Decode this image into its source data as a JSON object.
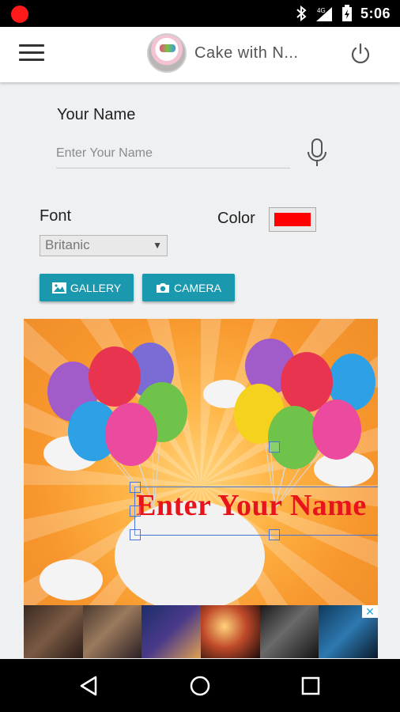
{
  "status_bar": {
    "time": "5:06",
    "network": "4G"
  },
  "app_bar": {
    "title": "Cake with N...",
    "menu_icon": "hamburger-menu-icon",
    "power_icon": "power-icon"
  },
  "form": {
    "name_label": "Your Name",
    "name_placeholder": "Enter Your Name",
    "font_label": "Font",
    "font_value": "Britanic",
    "color_label": "Color",
    "color_value": "#ff0000",
    "gallery_label": "GALLERY",
    "camera_label": "CAMERA"
  },
  "canvas": {
    "overlay_text": "Enter Your Name"
  },
  "ad": {
    "badge": "▷",
    "close": "✕"
  },
  "colors": {
    "accent": "#1a98ad",
    "text_red": "#e8141c"
  }
}
